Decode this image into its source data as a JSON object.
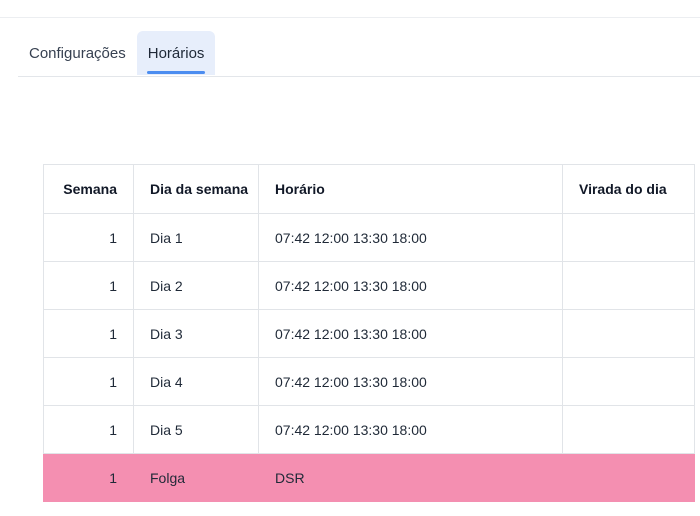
{
  "tabs": [
    {
      "label": "Configurações",
      "active": false
    },
    {
      "label": "Horários",
      "active": true
    }
  ],
  "table": {
    "headers": [
      "Semana",
      "Dia da semana",
      "Horário",
      "Virada do dia"
    ],
    "rows": [
      {
        "semana": "1",
        "dia": "Dia 1",
        "horario": "07:42 12:00 13:30 18:00",
        "virada": ""
      },
      {
        "semana": "1",
        "dia": "Dia 2",
        "horario": "07:42 12:00 13:30 18:00",
        "virada": ""
      },
      {
        "semana": "1",
        "dia": "Dia 3",
        "horario": "07:42 12:00 13:30 18:00",
        "virada": ""
      },
      {
        "semana": "1",
        "dia": "Dia 4",
        "horario": "07:42 12:00 13:30 18:00",
        "virada": ""
      },
      {
        "semana": "1",
        "dia": "Dia 5",
        "horario": "07:42 12:00 13:30 18:00",
        "virada": ""
      },
      {
        "semana": "1",
        "dia": "Folga",
        "horario": "DSR",
        "virada": ""
      }
    ]
  },
  "colors": {
    "accent": "#4c8df0",
    "active_tab_bg": "#e7eefb",
    "folga_row": "#f48fb1"
  }
}
